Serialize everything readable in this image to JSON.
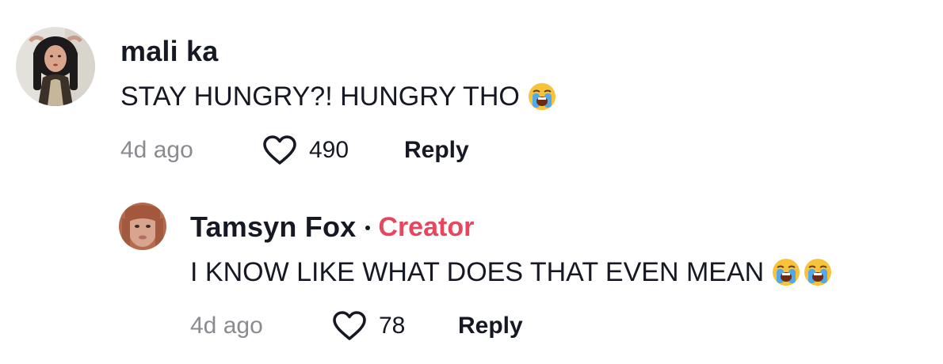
{
  "comments": [
    {
      "username": "mali ka",
      "text": "STAY HUNGRY?! HUNGRY THO",
      "emojis": [
        "loudly-crying-face"
      ],
      "timestamp": "4d ago",
      "likes": "490",
      "reply_label": "Reply",
      "avatar_icon": "user-avatar-photo"
    }
  ],
  "replies": [
    {
      "username": "Tamsyn Fox",
      "badge": "Creator",
      "text": "I KNOW LIKE WHAT DOES THAT EVEN MEAN",
      "emojis": [
        "loudly-crying-face",
        "loudly-crying-face"
      ],
      "timestamp": "4d ago",
      "likes": "78",
      "reply_label": "Reply",
      "avatar_icon": "creator-avatar-photo"
    }
  ],
  "icons": {
    "like": "heart-outline-icon",
    "emoji": "loudly-crying-face-emoji"
  },
  "colors": {
    "text": "#161823",
    "muted": "#8a8b91",
    "creator_badge": "#e8455e",
    "background": "#ffffff"
  }
}
